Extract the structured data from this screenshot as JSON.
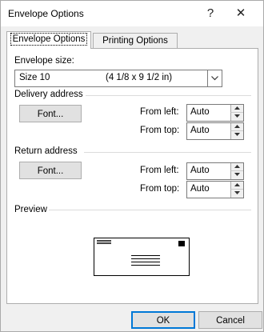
{
  "window": {
    "title": "Envelope Options",
    "help_glyph": "?",
    "close_glyph": "✕"
  },
  "tabs": [
    {
      "label": "Envelope Options",
      "active": true
    },
    {
      "label": "Printing Options",
      "active": false
    }
  ],
  "envelope_size": {
    "label": "Envelope size:",
    "selected": "Size 10",
    "dimensions": "(4 1/8 x 9 1/2 in)"
  },
  "delivery": {
    "heading": "Delivery address",
    "font_button": "Font...",
    "from_left_label": "From left:",
    "from_left_value": "Auto",
    "from_top_label": "From top:",
    "from_top_value": "Auto"
  },
  "return": {
    "heading": "Return address",
    "font_button": "Font...",
    "from_left_label": "From left:",
    "from_left_value": "Auto",
    "from_top_label": "From top:",
    "from_top_value": "Auto"
  },
  "preview": {
    "heading": "Preview"
  },
  "footer": {
    "ok_label": "OK",
    "cancel_label": "Cancel"
  },
  "colors": {
    "accent": "#0078d7",
    "dialog_bg": "#f0f0f0",
    "panel_bg": "#ffffff"
  }
}
